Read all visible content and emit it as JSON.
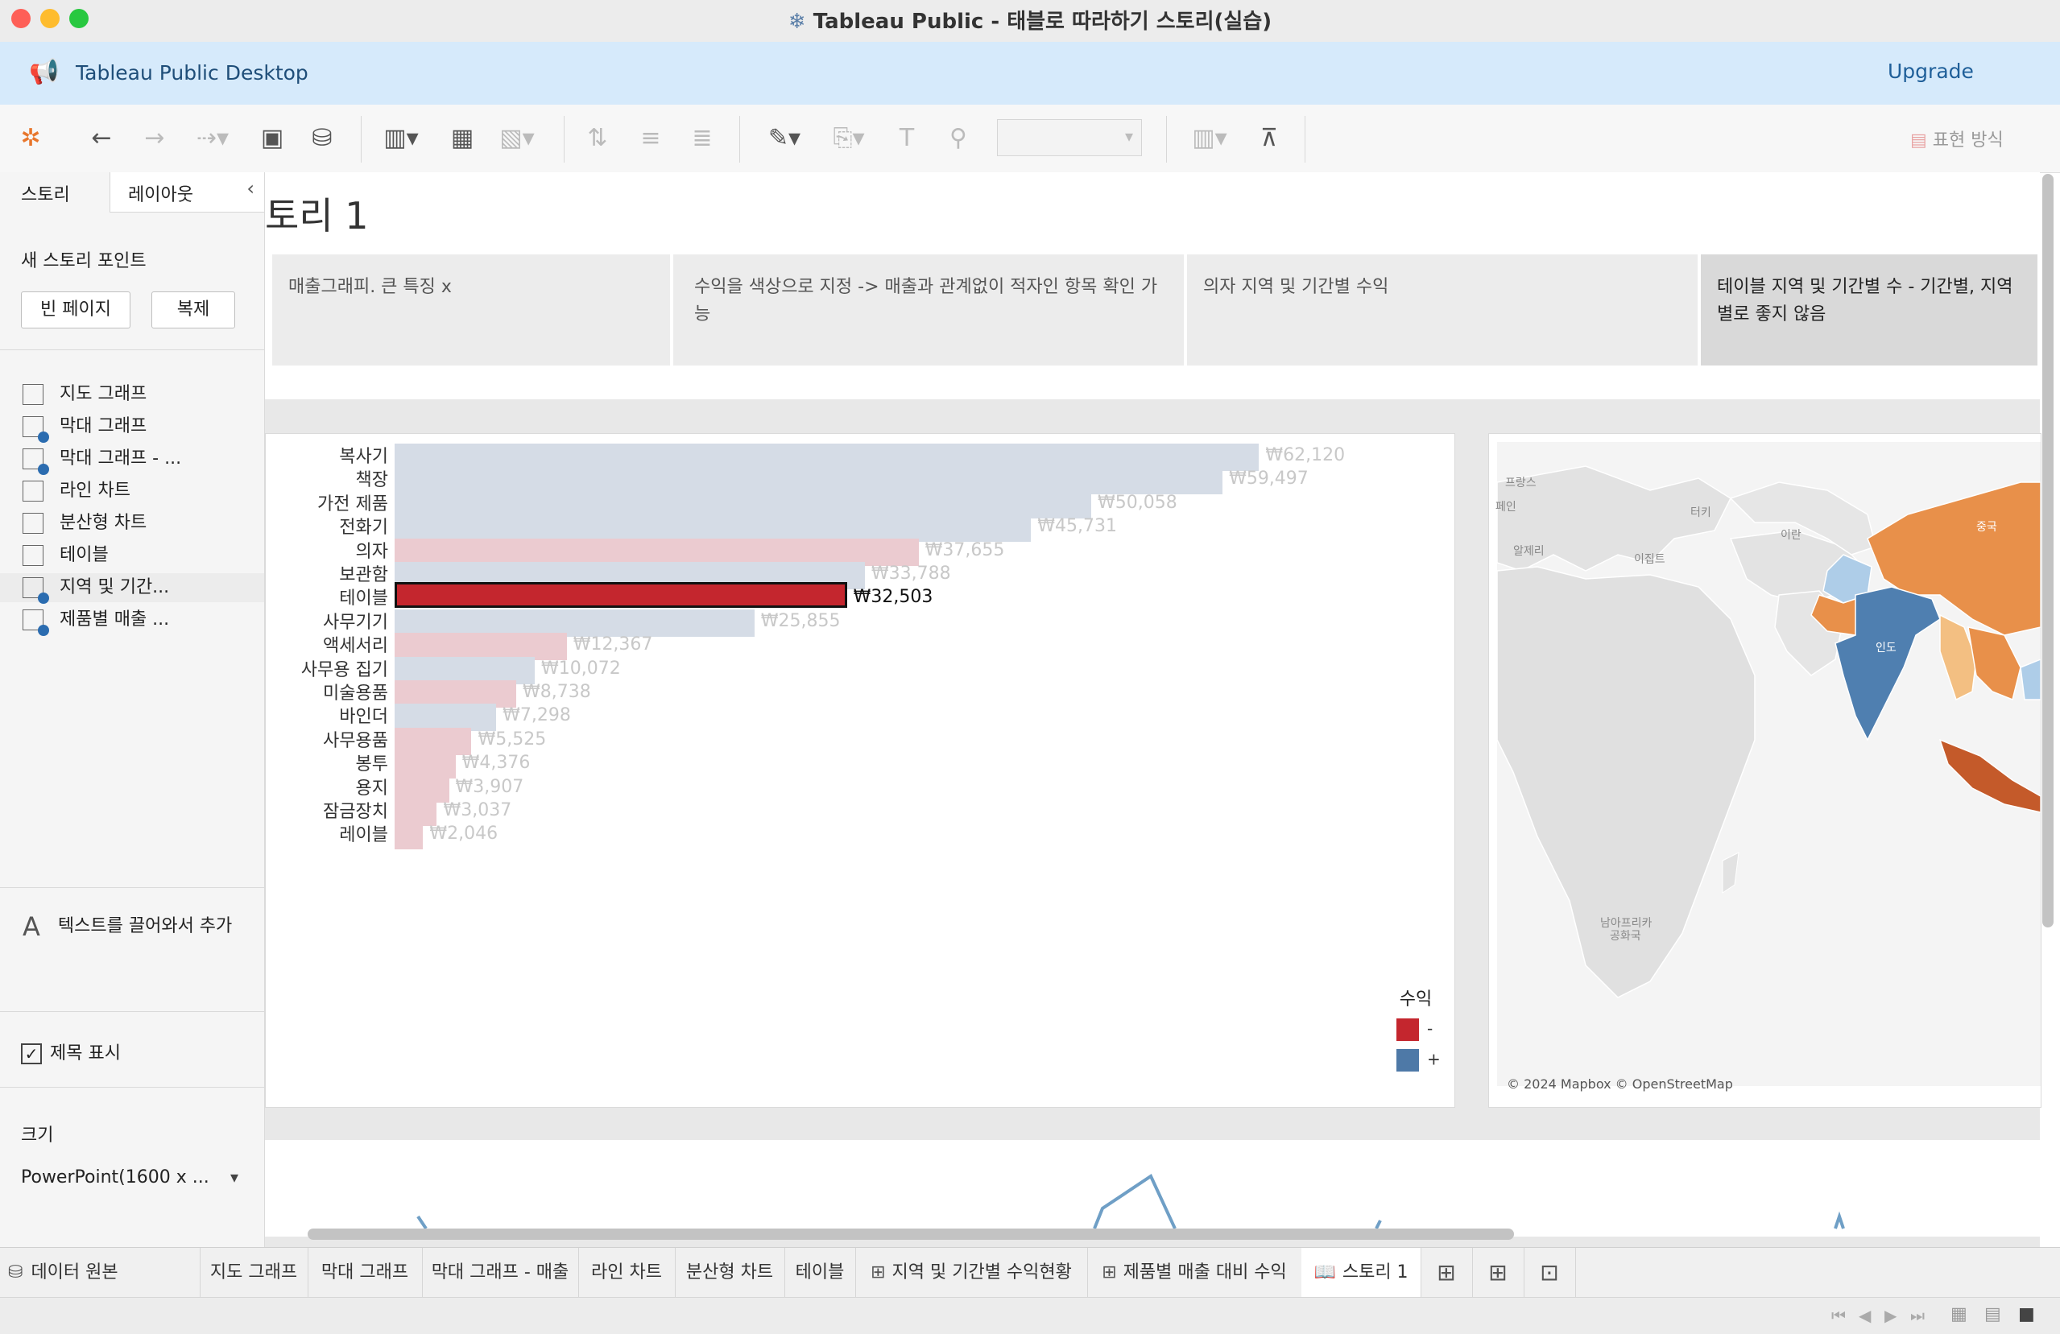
{
  "window": {
    "title": "Tableau Public - 태블로 따라하기 스토리(실습)"
  },
  "banner": {
    "app_name": "Tableau Public Desktop",
    "upgrade_label": "Upgrade"
  },
  "toolbar": {
    "presentation_label": "표현 방식"
  },
  "sidebar": {
    "tab_story": "스토리",
    "tab_layout": "레이아웃",
    "new_point_heading": "새 스토리 포인트",
    "blank_button": "빈 페이지",
    "duplicate_button": "복제",
    "sheets": [
      {
        "label": "지도 그래프"
      },
      {
        "label": "막대 그래프"
      },
      {
        "label": "막대 그래프 - ..."
      },
      {
        "label": "라인 차트"
      },
      {
        "label": "분산형 차트"
      },
      {
        "label": "테이블"
      },
      {
        "label": "지역 및 기간..."
      },
      {
        "label": "제품별 매출 ..."
      }
    ],
    "drag_text_label": "텍스트를 끌어와서 추가",
    "show_title_label": "제목 표시",
    "size_heading": "크기",
    "size_value": "PowerPoint(1600 x ..."
  },
  "story": {
    "title": "토리 1",
    "points": [
      {
        "text": "매출그래피. 큰 특징 x"
      },
      {
        "text": "수익을 색상으로 지정 -> 매출과 관계없이 적자인 항목 확인 가능"
      },
      {
        "text": "의자 지역 및 기간별 수익"
      },
      {
        "text": "테이블 지역 및 기간별 수 - 기간별, 지역별로 좋지 않음"
      }
    ]
  },
  "legend": {
    "title": "수익",
    "neg_label": "-",
    "pos_label": "+"
  },
  "map": {
    "credit": "© 2024 Mapbox © OpenStreetMap",
    "labels": [
      {
        "text": "프랑스"
      },
      {
        "text": "페인"
      },
      {
        "text": "터키"
      },
      {
        "text": "이란"
      },
      {
        "text": "알제리"
      },
      {
        "text": "이집트"
      },
      {
        "text": "중국"
      },
      {
        "text": "인도"
      },
      {
        "text": "남아프리카"
      },
      {
        "text": "공화국"
      }
    ]
  },
  "chart_data": {
    "type": "bar",
    "orientation": "horizontal",
    "categories": [
      "복사기",
      "책장",
      "가전 제품",
      "전화기",
      "의자",
      "보관함",
      "테이블",
      "사무기기",
      "액세서리",
      "사무용 집기",
      "미술용품",
      "바인더",
      "사무용품",
      "봉투",
      "용지",
      "잠금장치",
      "레이블"
    ],
    "values": [
      62120,
      59497,
      50058,
      45731,
      37655,
      33788,
      32503,
      25855,
      12367,
      10072,
      8738,
      7298,
      5525,
      4376,
      3907,
      3037,
      2046
    ],
    "value_labels": [
      "₩62,120",
      "₩59,497",
      "₩50,058",
      "₩45,731",
      "₩37,655",
      "₩33,788",
      "₩32,503",
      "₩25,855",
      "₩12,367",
      "₩10,072",
      "₩8,738",
      "₩7,298",
      "₩5,525",
      "₩4,376",
      "₩3,907",
      "₩3,037",
      "₩2,046"
    ],
    "profit_sign": [
      "+",
      "+",
      "+",
      "+",
      "-",
      "+",
      "-",
      "+",
      "-",
      "+",
      "-",
      "+",
      "-",
      "-",
      "-",
      "-",
      "-"
    ],
    "highlighted": "테이블",
    "colors": {
      "negative": "#c4262e",
      "positive": "#4e79a7",
      "negative_faded": "#ebcbd0",
      "positive_faded": "#d5dce6"
    }
  },
  "tabs": [
    {
      "label": "데이터 원본"
    },
    {
      "label": "지도 그래프"
    },
    {
      "label": "막대 그래프"
    },
    {
      "label": "막대 그래프 - 매출"
    },
    {
      "label": "라인 차트"
    },
    {
      "label": "분산형 차트"
    },
    {
      "label": "테이블"
    },
    {
      "label": "지역 및 기간별 수익현황"
    },
    {
      "label": "제품별 매출 대비 수익"
    },
    {
      "label": "스토리 1"
    }
  ]
}
